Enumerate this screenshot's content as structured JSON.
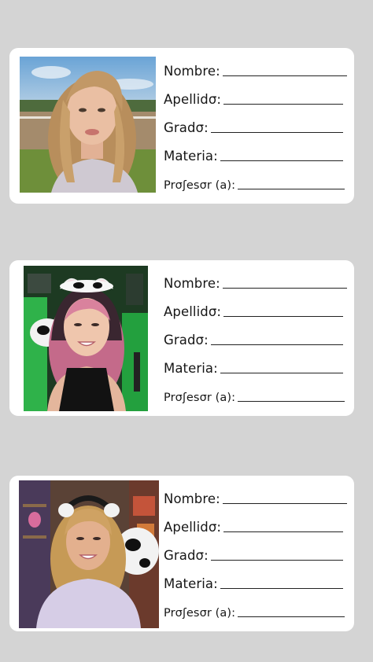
{
  "labels": {
    "nombre": "Nombre:",
    "apellido": "Apellidσ:",
    "grado": "Gradσ:",
    "materia": "Materia:",
    "profesor": "Prσʃesσr (a):"
  },
  "colors": {
    "background": "#d4d4d4",
    "card": "#ffffff",
    "text": "#161616"
  }
}
